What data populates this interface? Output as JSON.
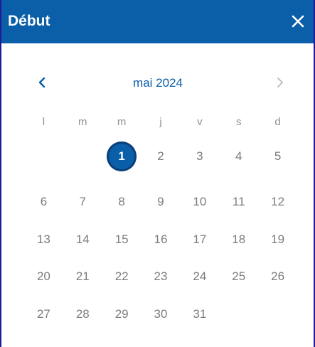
{
  "dialog": {
    "title": "Début",
    "close_icon": "close-icon"
  },
  "calendar": {
    "month_label": "mai 2024",
    "prev_icon": "chevron-left-icon",
    "next_icon": "chevron-right-icon",
    "weekdays": [
      "l",
      "m",
      "m",
      "j",
      "v",
      "s",
      "d"
    ],
    "weeks": [
      [
        "",
        "",
        "1",
        "2",
        "3",
        "4",
        "5"
      ],
      [
        "6",
        "7",
        "8",
        "9",
        "10",
        "11",
        "12"
      ],
      [
        "13",
        "14",
        "15",
        "16",
        "17",
        "18",
        "19"
      ],
      [
        "20",
        "21",
        "22",
        "23",
        "24",
        "25",
        "26"
      ],
      [
        "27",
        "28",
        "29",
        "30",
        "31",
        "",
        ""
      ]
    ],
    "selected_day": "1"
  },
  "colors": {
    "header_bg": "#0b5ea8",
    "accent": "#0b5ea8",
    "frame_border": "#1f1a9a",
    "text_muted": "#7c7c7c"
  }
}
